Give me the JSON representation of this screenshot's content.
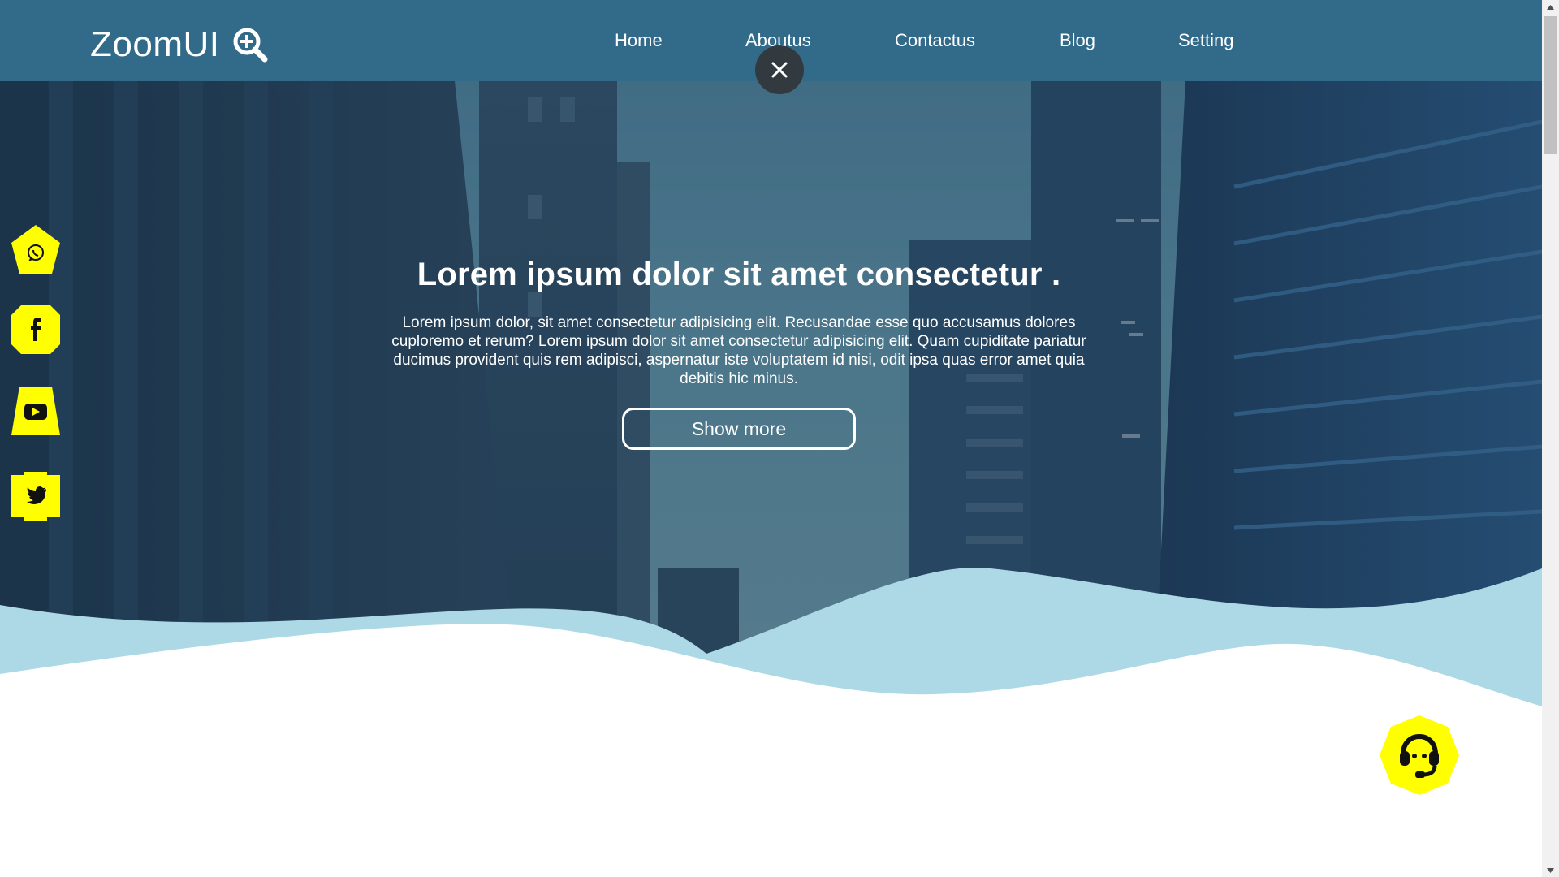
{
  "brand": {
    "name": "ZoomUI",
    "logo_icon": "zoom-in-icon"
  },
  "nav": {
    "items": [
      {
        "label": "Home"
      },
      {
        "label": "Aboutus"
      },
      {
        "label": "Contactus"
      },
      {
        "label": "Blog"
      },
      {
        "label": "Setting"
      }
    ]
  },
  "overlay": {
    "close_icon": "close-icon"
  },
  "hero": {
    "title": "Lorem ipsum dolor sit amet consectetur .",
    "text": "Lorem ipsum dolor, sit amet consectetur adipisicing elit. Recusandae esse quo accusamus dolores cuploremo et rerum? Lorem ipsum dolor sit amet consectetur adipisicing elit. Quam cupiditate pariatur ducimus provident quis rem adipisci, aspernatur iste voluptatem id nisi, odit ipsa quas error amet quia debitis hic minus.",
    "button_label": "Show more"
  },
  "social": [
    {
      "icon": "whatsapp-icon"
    },
    {
      "icon": "facebook-icon"
    },
    {
      "icon": "youtube-icon"
    },
    {
      "icon": "twitter-icon"
    }
  ],
  "support": {
    "icon": "headset-icon"
  },
  "colors": {
    "header": "#326a8a",
    "accent_yellow": "#ffff00",
    "wave_light": "#add8e6",
    "close_button": "#333a3f"
  }
}
